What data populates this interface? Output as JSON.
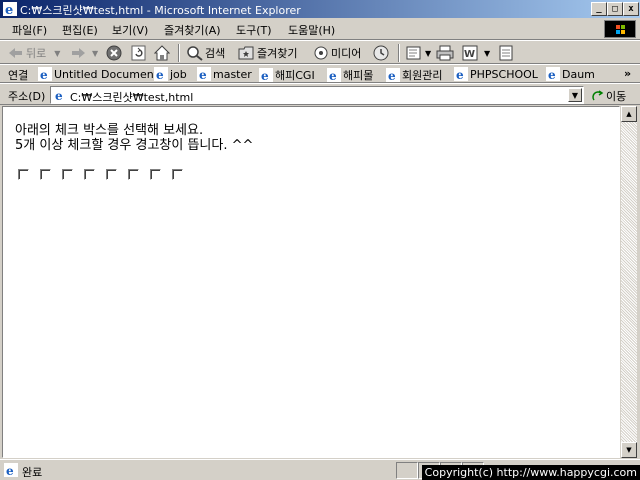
{
  "window": {
    "title": "C:₩스크린샷₩test,html - Microsoft Internet Explorer",
    "buttons": {
      "minimize": "_",
      "maximize": "□",
      "close": "x"
    }
  },
  "menu": [
    "파일(F)",
    "편집(E)",
    "보기(V)",
    "즐겨찾기(A)",
    "도구(T)",
    "도움말(H)"
  ],
  "toolbar": {
    "back": "뒤로",
    "search": "검색",
    "favorites": "즐겨찾기",
    "media": "미디어"
  },
  "links": {
    "label": "연결",
    "items": [
      "Untitled Document",
      "job",
      "master",
      "해피CGI",
      "해피몰",
      "회원관리",
      "PHPSCHOOL",
      "Daum"
    ],
    "more": "»"
  },
  "address": {
    "label": "주소(D)",
    "value": "C:₩스크린샷₩test,html",
    "go": "이동"
  },
  "content": {
    "line1": "아래의 체크 박스를 선택해 보세요.",
    "line2": "5개 이상 체크할 경우 경고창이 뜹니다. ^^",
    "checkbox_count": 8
  },
  "status": {
    "text": "완료",
    "copyright": "Copyright(c) http://www.happycgi.com"
  },
  "colors": {
    "titlebar_start": "#0a246a",
    "titlebar_end": "#a6caf0",
    "chrome": "#d4d0c8"
  }
}
